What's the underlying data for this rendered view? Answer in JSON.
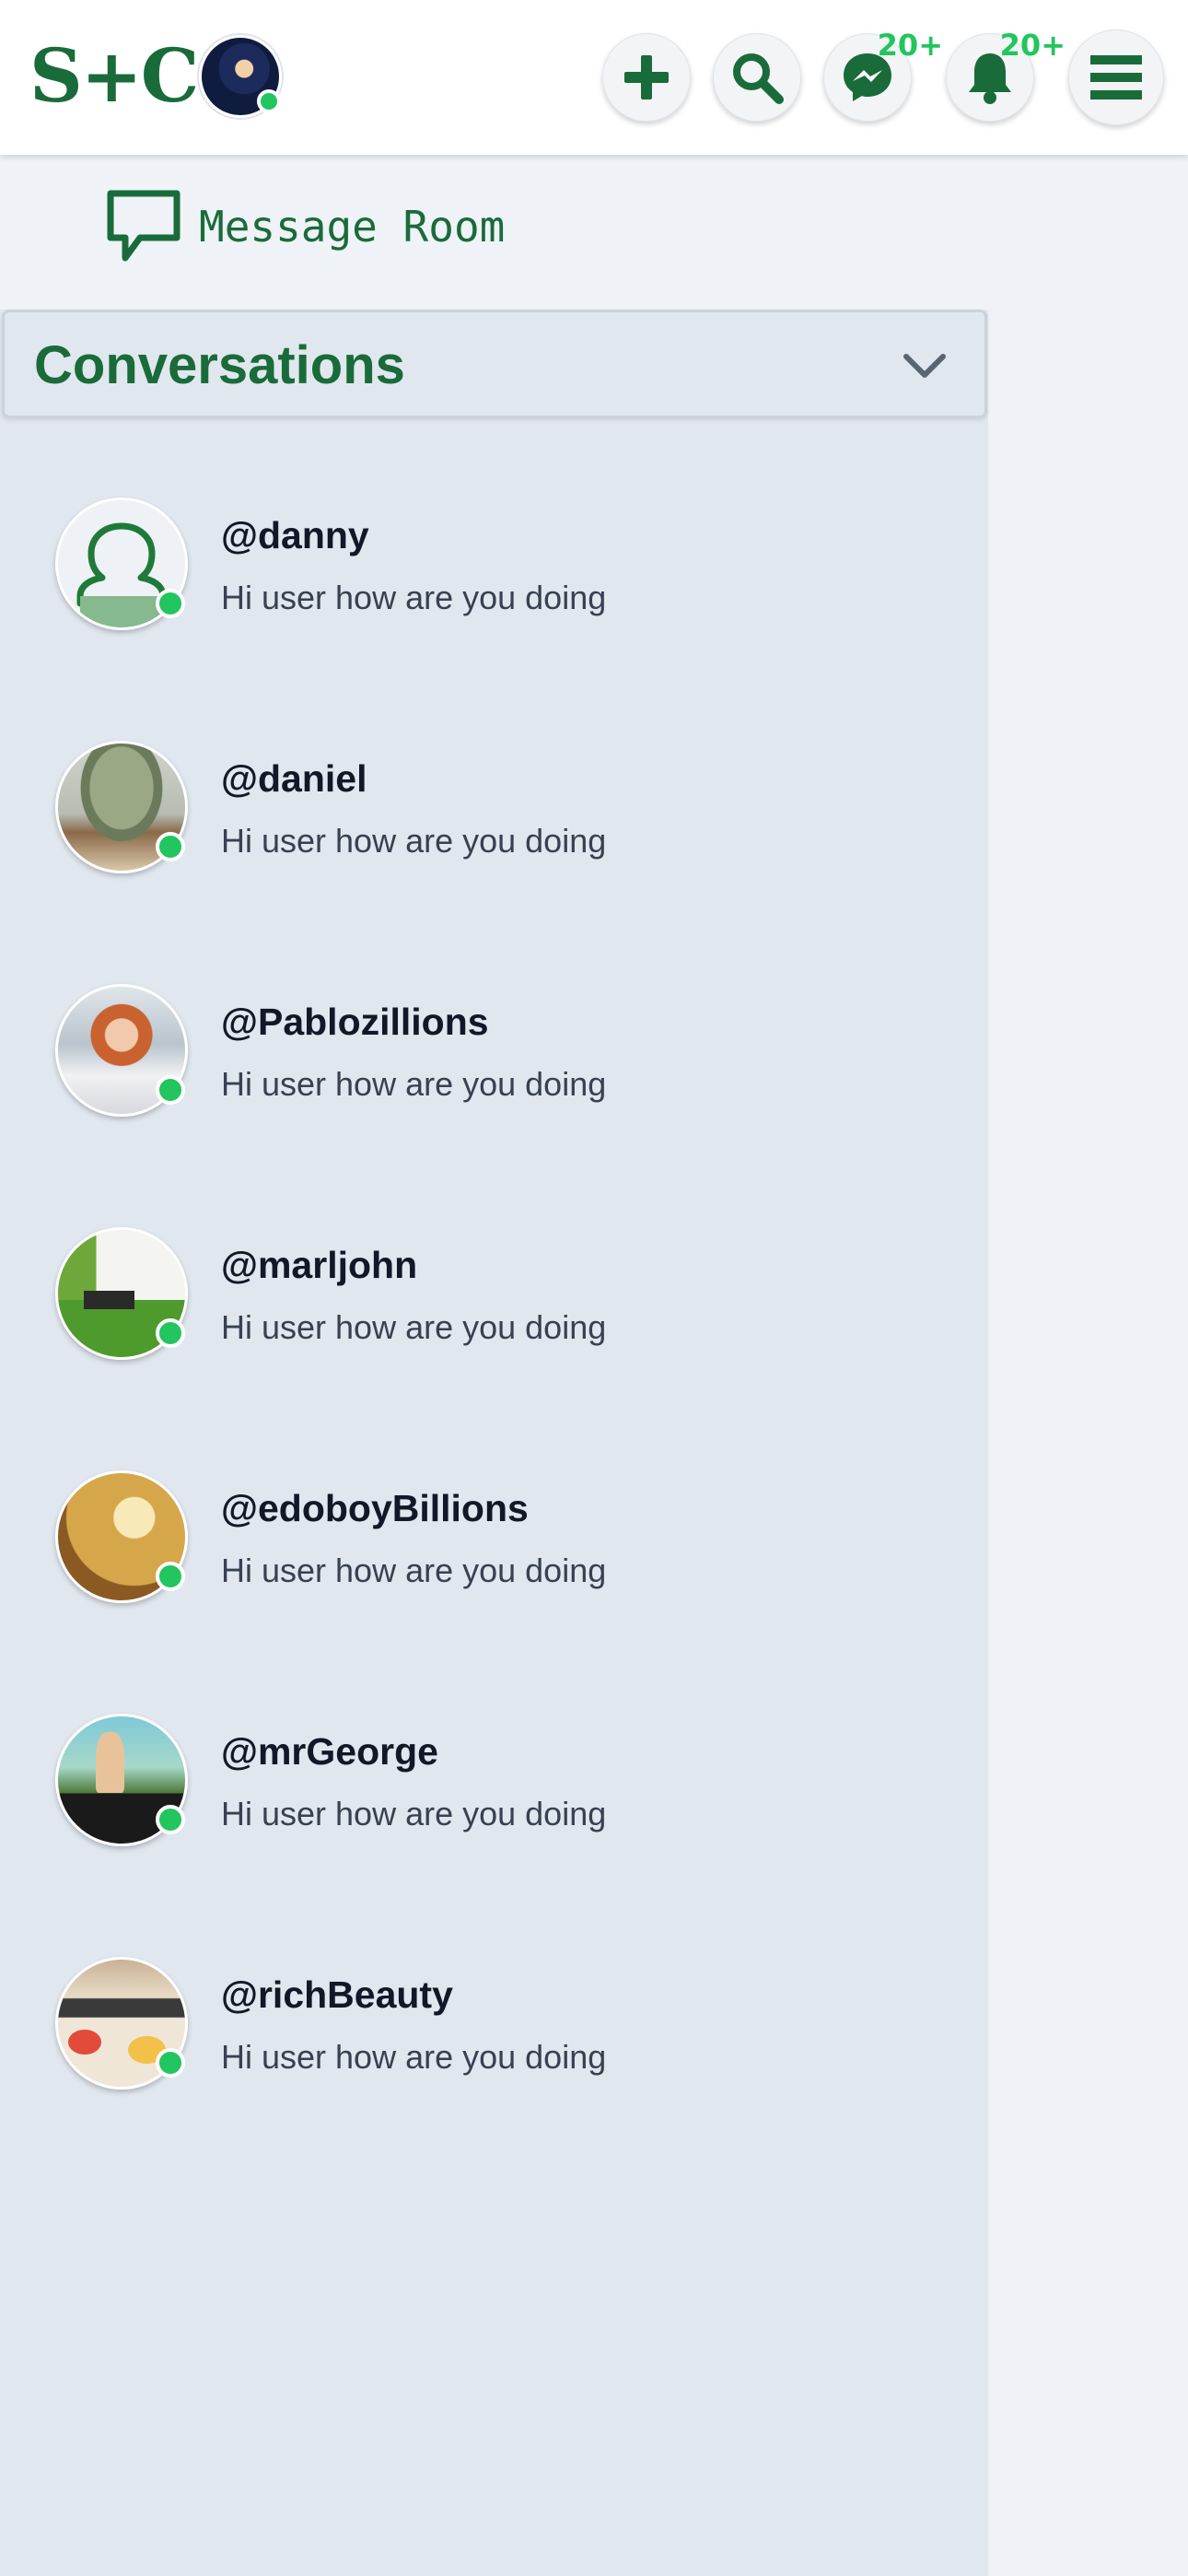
{
  "header": {
    "logo": "S+C",
    "messages_badge": "20+",
    "notifications_badge": "20+",
    "icons": [
      "plus-icon",
      "search-icon",
      "messenger-icon",
      "bell-icon",
      "menu-icon"
    ]
  },
  "room": {
    "label": "Message Room"
  },
  "conversations": {
    "title": "Conversations",
    "items": [
      {
        "username": "@danny",
        "message": "Hi user how are you doing",
        "online": true
      },
      {
        "username": "@daniel",
        "message": "Hi user how are you doing",
        "online": true
      },
      {
        "username": "@Pablozillions",
        "message": "Hi user how are you doing",
        "online": true
      },
      {
        "username": "@marljohn",
        "message": "Hi user how are you doing",
        "online": true
      },
      {
        "username": "@edoboyBillions",
        "message": "Hi user how are you doing",
        "online": true
      },
      {
        "username": "@mrGeorge",
        "message": "Hi user how are you doing",
        "online": true
      },
      {
        "username": "@richBeauty",
        "message": "Hi user how are you doing",
        "online": true
      }
    ]
  },
  "colors": {
    "brand_green": "#1a6b3a",
    "online_green": "#22c55e",
    "panel_bg": "#e1e7ef",
    "page_bg": "#eff2f7"
  }
}
